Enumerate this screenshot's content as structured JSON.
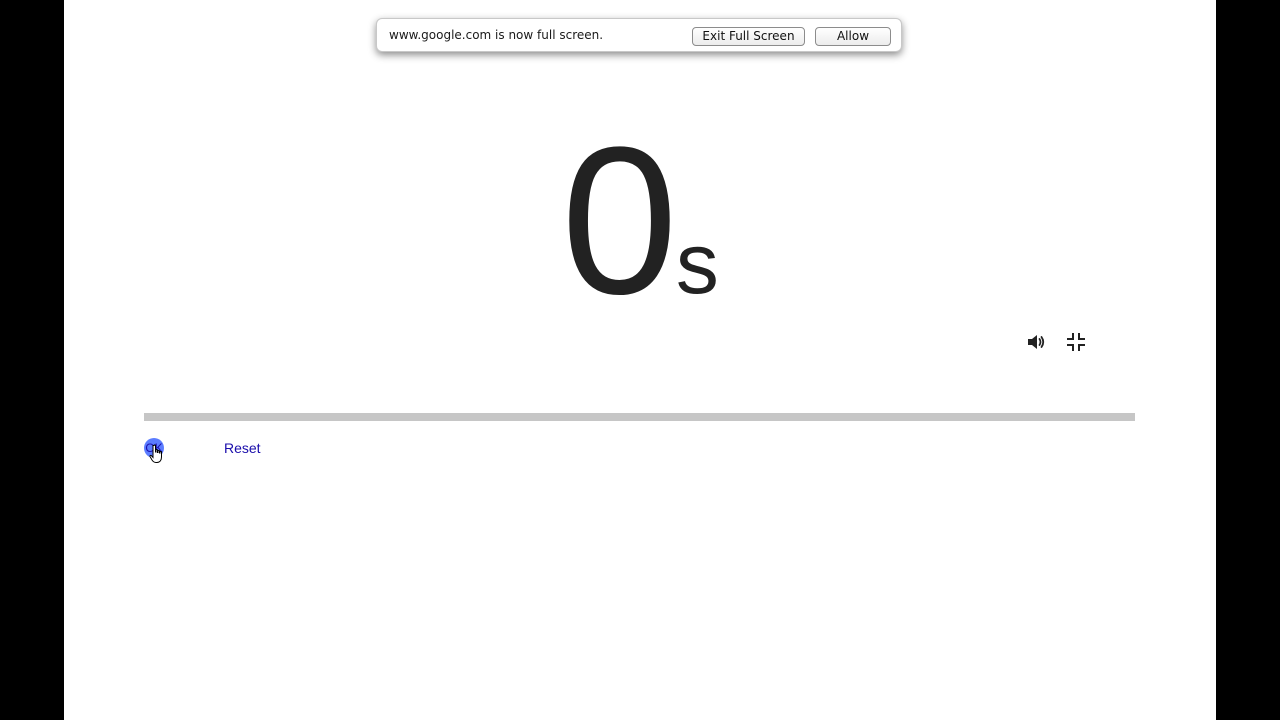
{
  "fullscreen_bubble": {
    "message": "www.google.com is now full screen.",
    "exit_label": "Exit Full Screen",
    "allow_label": "Allow"
  },
  "timer": {
    "value": "0",
    "unit": "s",
    "progress_fraction": 0
  },
  "controls": {
    "sound_icon": "speaker-icon",
    "exit_fullscreen_icon": "exit-fullscreen-icon"
  },
  "actions": {
    "ok_label": "OK",
    "reset_label": "Reset"
  },
  "colors": {
    "progress_track": "#c6c6c6",
    "link": "#1a0dab",
    "ok_highlight": "#5b7cff"
  }
}
